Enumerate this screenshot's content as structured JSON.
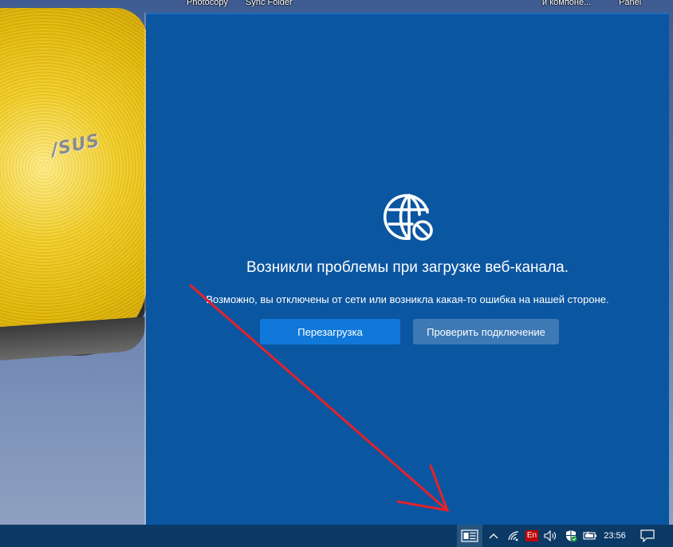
{
  "desktop": {
    "shortcuts": [
      "Photocopy",
      "Sync Folder",
      "и компоне...",
      "Panel"
    ],
    "logo_text": "/SUS"
  },
  "feed": {
    "error_title": "Возникли проблемы при загрузке веб-канала.",
    "error_description": "Возможно, вы отключены от сети или возникла какая-то ошибка на нашей стороне.",
    "reload_label": "Перезагрузка",
    "check_connection_label": "Проверить подключение",
    "icon": "globe-blocked-icon"
  },
  "taskbar": {
    "language": "En",
    "time": "23:56",
    "tray_icons": [
      "news-widget-icon",
      "chevron-up-icon",
      "wifi-icon",
      "language-icon",
      "volume-icon",
      "security-shield-icon",
      "battery-icon",
      "notifications-icon"
    ]
  },
  "colors": {
    "panel_bg": "#0b56a1",
    "primary_button": "#1078d8",
    "secondary_button": "#3d79b4",
    "taskbar": "#0c3a66",
    "annotation_arrow": "#e8202a"
  }
}
